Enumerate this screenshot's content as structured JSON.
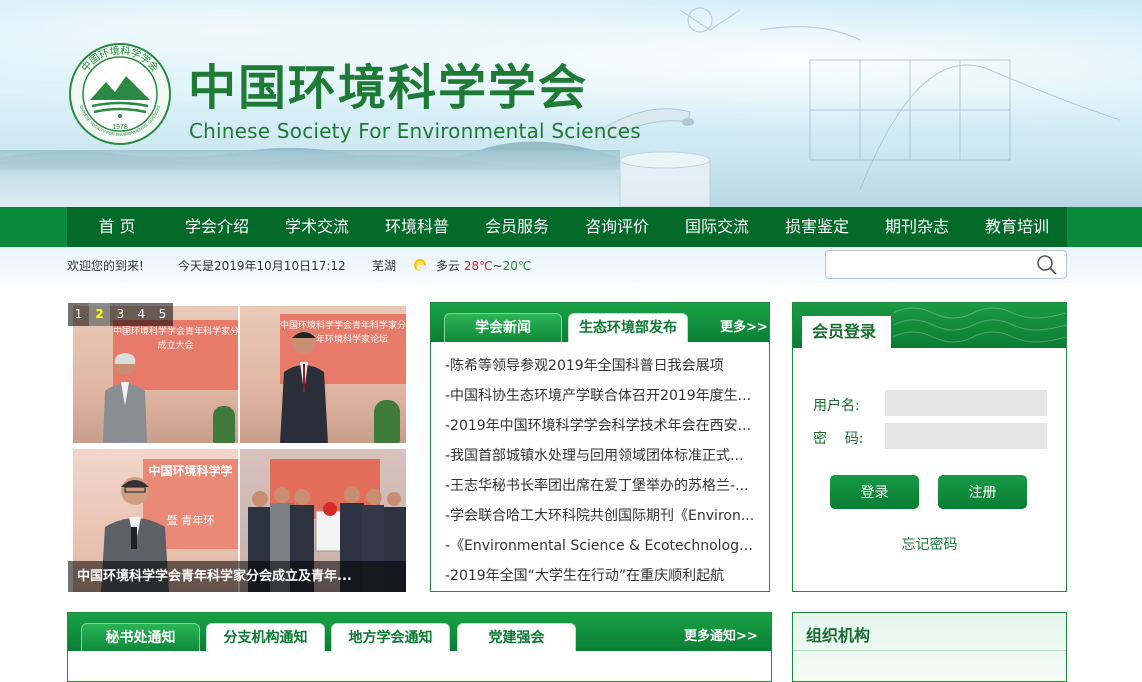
{
  "header": {
    "title_cn": "中国环境科学学会",
    "title_en": "Chinese Society For Environmental Sciences",
    "logo_year": "1978",
    "logo_ring_cn": "中国环境科学学会",
    "logo_ring_en": "CHINESE SOCIETY FOR ENVIRONMENTAL SCIENCES"
  },
  "nav": {
    "items": [
      {
        "label": "首 页"
      },
      {
        "label": "学会介绍"
      },
      {
        "label": "学术交流"
      },
      {
        "label": "环境科普"
      },
      {
        "label": "会员服务"
      },
      {
        "label": "咨询评价"
      },
      {
        "label": "国际交流"
      },
      {
        "label": "损害鉴定"
      },
      {
        "label": "期刊杂志"
      },
      {
        "label": "教育培训"
      }
    ]
  },
  "infobar": {
    "welcome": "欢迎您的到来!",
    "datetime": "今天是2019年10月10日17:12",
    "city": "芜湖",
    "weather": "多云",
    "temp_high": "28℃",
    "temp_sep": "~",
    "temp_low": "20℃",
    "search_placeholder": ""
  },
  "slider": {
    "page_numbers": [
      "1",
      "2",
      "3",
      "4",
      "5"
    ],
    "active_page": "2",
    "screen_text_1": "中国环境科学学会青年科学家分会",
    "screen_text_2": "成立大会",
    "screen_text_3": "暨青年环境科学家论坛",
    "screen_text_4": "中国环境科学学",
    "screen_text_5": "暨 青年环",
    "caption": "中国环境科学学会青年科学家分会成立及青年..."
  },
  "news": {
    "tabs": [
      {
        "label": "学会新闻"
      },
      {
        "label": "生态环境部发布"
      }
    ],
    "more": "更多>>",
    "items": [
      "-陈希等领导参观2019年全国科普日我会展项",
      "-中国科协生态环境产学联合体召开2019年度生...",
      "-2019年中国环境科学学会科学技术年会在西安...",
      "-我国首部城镇水处理与回用领域团体标准正式...",
      "-王志华秘书长率团出席在爱丁堡举办的苏格兰-...",
      "-学会联合哈工大环科院共创国际期刊《Environ...",
      "-《Environmental Science & Ecotechnology...",
      "-2019年全国“大学生在行动”在重庆顺利起航"
    ]
  },
  "login": {
    "title": "会员登录",
    "username_label": "用户名:",
    "password_label": "密    码:",
    "login_button": "登录",
    "register_button": "注册",
    "forgot": "忘记密码"
  },
  "notice": {
    "tabs": [
      {
        "label": "秘书处通知"
      },
      {
        "label": "分支机构通知"
      },
      {
        "label": "地方学会通知"
      },
      {
        "label": "党建强会"
      }
    ],
    "more": "更多通知>>"
  },
  "org": {
    "title": "组织机构"
  },
  "colors": {
    "brand_green": "#1e7a35",
    "nav_green": "#046a2a",
    "temp_high": "#d8231e",
    "temp_low": "#2e8b2e"
  }
}
